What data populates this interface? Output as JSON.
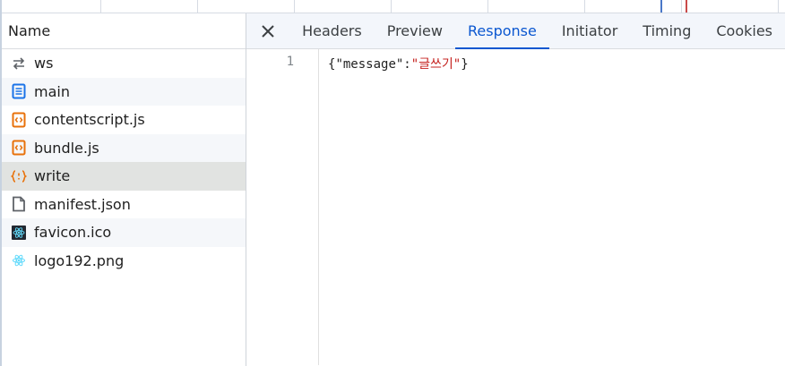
{
  "name_panel": {
    "header": "Name",
    "files": [
      {
        "name": "ws",
        "icon": "websocket-icon"
      },
      {
        "name": "main",
        "icon": "document-icon"
      },
      {
        "name": "contentscript.js",
        "icon": "script-icon"
      },
      {
        "name": "bundle.js",
        "icon": "script-icon"
      },
      {
        "name": "write",
        "icon": "fetch-icon"
      },
      {
        "name": "manifest.json",
        "icon": "file-icon"
      },
      {
        "name": "favicon.ico",
        "icon": "react-favicon-icon"
      },
      {
        "name": "logo192.png",
        "icon": "react-logo-icon"
      }
    ]
  },
  "detail_panel": {
    "tabs": [
      "Headers",
      "Preview",
      "Response",
      "Initiator",
      "Timing",
      "Cookies"
    ],
    "active_tab": "Response",
    "response": {
      "line_number": "1",
      "open": "{",
      "key": "\"message\"",
      "colon": ":",
      "value": "\"글쓰기\"",
      "close": "}"
    }
  },
  "colors": {
    "accent": "#0b57d0",
    "selected_row": "#e1e3e1",
    "string": "#c5221f"
  }
}
